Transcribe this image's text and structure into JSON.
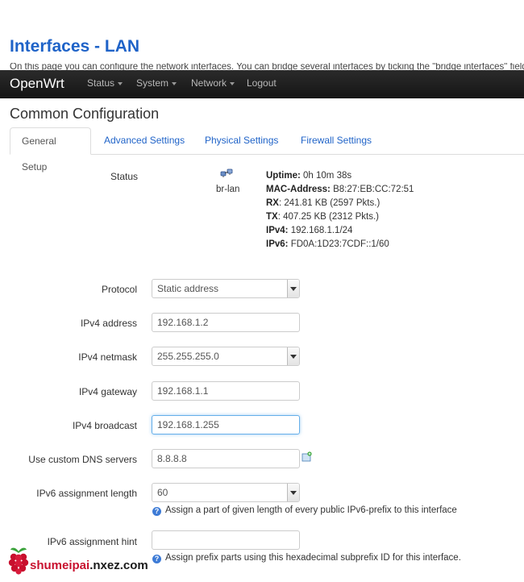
{
  "page": {
    "title": "Interfaces - LAN",
    "intro": "On this page you can configure the network interfaces. You can bridge several interfaces by ticking the \"bridge interfaces\" field"
  },
  "navbar": {
    "brand": "OpenWrt",
    "items": [
      {
        "label": "Status"
      },
      {
        "label": "System"
      },
      {
        "label": "Network"
      },
      {
        "label": "Logout"
      }
    ]
  },
  "section": {
    "title": "Common Configuration"
  },
  "tabs": [
    {
      "label": "General Setup",
      "active": true
    },
    {
      "label": "Advanced Settings"
    },
    {
      "label": "Physical Settings"
    },
    {
      "label": "Firewall Settings"
    }
  ],
  "status": {
    "label": "Status",
    "interface": "br-lan",
    "uptime_label": "Uptime:",
    "uptime": "0h 10m 38s",
    "mac_label": "MAC-Address:",
    "mac": "B8:27:EB:CC:72:51",
    "rx_label": "RX",
    "rx": ": 241.81 KB (2597 Pkts.)",
    "tx_label": "TX",
    "tx": ": 407.25 KB (2312 Pkts.)",
    "ipv4_label": "IPv4:",
    "ipv4": "192.168.1.1/24",
    "ipv6_label": "IPv6:",
    "ipv6": "FD0A:1D23:7CDF::1/60"
  },
  "form": {
    "protocol": {
      "label": "Protocol",
      "value": "Static address"
    },
    "ipv4_address": {
      "label": "IPv4 address",
      "value": "192.168.1.2"
    },
    "ipv4_netmask": {
      "label": "IPv4 netmask",
      "value": "255.255.255.0"
    },
    "ipv4_gateway": {
      "label": "IPv4 gateway",
      "value": "192.168.1.1"
    },
    "ipv4_broadcast": {
      "label": "IPv4 broadcast",
      "value": "192.168.1.255"
    },
    "dns": {
      "label": "Use custom DNS servers",
      "value": "8.8.8.8"
    },
    "ipv6_length": {
      "label": "IPv6 assignment length",
      "value": "60",
      "help": "Assign a part of given length of every public IPv6-prefix to this interface"
    },
    "ipv6_hint": {
      "label": "IPv6 assignment hint",
      "value": "",
      "help": "Assign prefix parts using this hexadecimal subprefix ID for this interface."
    }
  },
  "watermark": {
    "brand": "shumeipai",
    "domain": ".nxez.com"
  },
  "colors": {
    "link": "#1f63c8",
    "navbar": "#1c1c1c",
    "help_icon": "#3d7bd6"
  }
}
